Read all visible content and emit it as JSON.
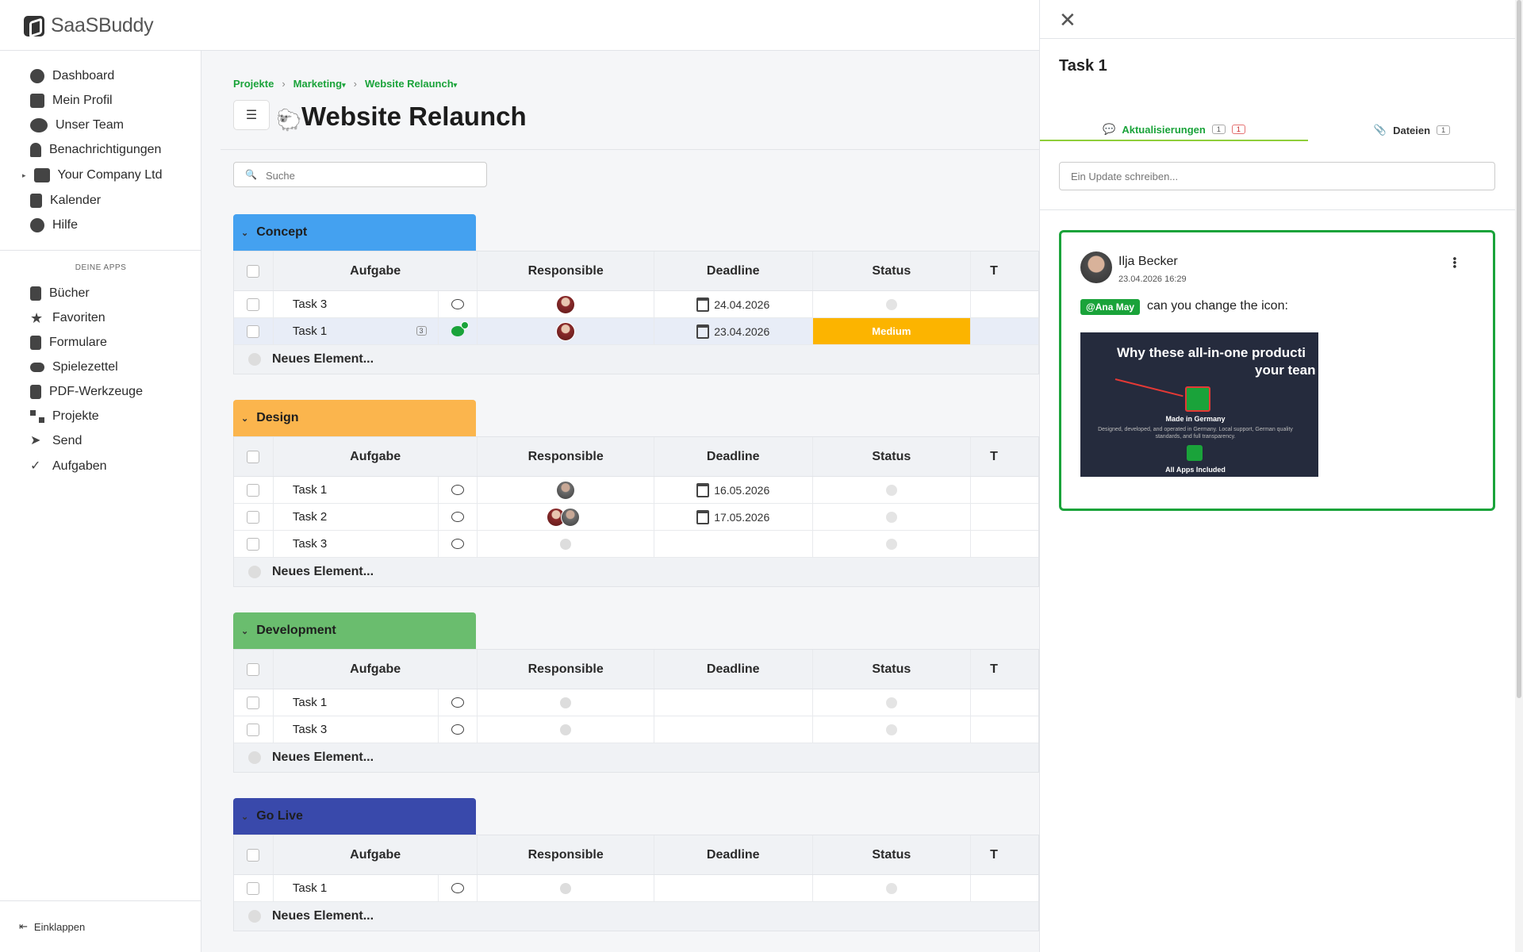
{
  "app": {
    "name": "SaaSBuddy",
    "collapse": "Einklappen"
  },
  "sidebar": {
    "items": [
      {
        "label": "Dashboard",
        "icon": "dashboard-icon"
      },
      {
        "label": "Mein Profil",
        "icon": "home-icon"
      },
      {
        "label": "Unser Team",
        "icon": "team-icon"
      },
      {
        "label": "Benachrichtigungen",
        "icon": "bell-icon"
      },
      {
        "label": "Your Company Ltd",
        "icon": "building-icon"
      },
      {
        "label": "Kalender",
        "icon": "calendar-icon"
      },
      {
        "label": "Hilfe",
        "icon": "help-icon"
      }
    ],
    "section": "DEINE APPS",
    "apps": [
      {
        "label": "Bücher",
        "icon": "book-icon"
      },
      {
        "label": "Favoriten",
        "icon": "star-icon"
      },
      {
        "label": "Formulare",
        "icon": "form-icon"
      },
      {
        "label": "Spielezettel",
        "icon": "gamepad-icon"
      },
      {
        "label": "PDF-Werkzeuge",
        "icon": "pdf-icon"
      },
      {
        "label": "Projekte",
        "icon": "projects-icon"
      },
      {
        "label": "Send",
        "icon": "send-icon"
      },
      {
        "label": "Aufgaben",
        "icon": "tasks-icon"
      }
    ]
  },
  "breadcrumb": [
    "Projekte",
    "Marketing",
    "Website Relaunch"
  ],
  "page": {
    "title": "Website Relaunch"
  },
  "search": {
    "placeholder": "Suche",
    "value": ""
  },
  "columns": {
    "task": "Aufgabe",
    "responsible": "Responsible",
    "deadline": "Deadline",
    "status": "Status",
    "extra": "T"
  },
  "new_item": "Neues Element...",
  "groups": [
    {
      "name": "Concept",
      "color": "#44a1f0",
      "rows": [
        {
          "task": "Task 3",
          "deadline": "24.04.2026",
          "status": ""
        },
        {
          "task": "Task 1",
          "count": "3",
          "deadline": "23.04.2026",
          "status": "Medium"
        }
      ]
    },
    {
      "name": "Design",
      "color": "#fbb54d",
      "rows": [
        {
          "task": "Task 1",
          "deadline": "16.05.2026",
          "status": ""
        },
        {
          "task": "Task 2",
          "deadline": "17.05.2026",
          "status": ""
        },
        {
          "task": "Task 3",
          "deadline": "",
          "status": ""
        }
      ]
    },
    {
      "name": "Development",
      "color": "#6abd6e",
      "rows": [
        {
          "task": "Task 1",
          "deadline": "",
          "status": ""
        },
        {
          "task": "Task 3",
          "deadline": "",
          "status": ""
        }
      ]
    },
    {
      "name": "Go Live",
      "color": "#3949ab",
      "rows": [
        {
          "task": "Task 1",
          "deadline": "",
          "status": ""
        }
      ]
    }
  ],
  "panel": {
    "title": "Task 1",
    "tabs": {
      "updates": "Aktualisierungen",
      "updates_count": "1",
      "updates_unread": "1",
      "files": "Dateien",
      "files_count": "1"
    },
    "update_placeholder": "Ein Update schreiben...",
    "post": {
      "author": "Ilja Becker",
      "time": "23.04.2026 16:29",
      "mention": "@Ana May",
      "text": "can you change the icon:",
      "image": {
        "heading1": "Why these all-in-one producti",
        "heading2": "your tean",
        "caption1": "Made in Germany",
        "body": "Designed, developed, and operated in Germany. Local support, German quality standards, and full transparency.",
        "caption2": "All Apps Included"
      }
    }
  },
  "colors": {
    "accent": "#1aa33a",
    "status_medium": "#fcb400"
  }
}
